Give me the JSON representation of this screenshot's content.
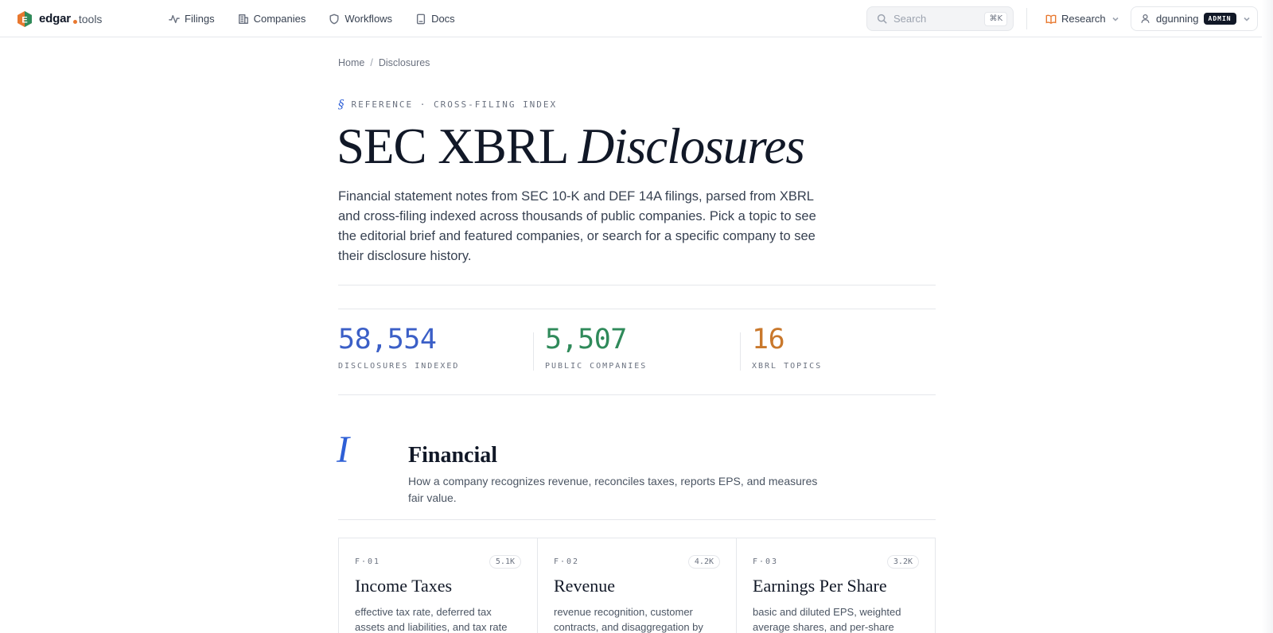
{
  "brand": {
    "logo_letter": "E",
    "name": "edgar",
    "suffix": "tools"
  },
  "nav": [
    {
      "label": "Filings",
      "icon": "activity-icon"
    },
    {
      "label": "Companies",
      "icon": "building-icon"
    },
    {
      "label": "Workflows",
      "icon": "shield-icon"
    },
    {
      "label": "Docs",
      "icon": "document-icon"
    }
  ],
  "search": {
    "placeholder": "Search",
    "shortcut": "⌘K"
  },
  "research": {
    "label": "Research"
  },
  "user": {
    "name": "dgunning",
    "badge": "ADMIN"
  },
  "breadcrumb": {
    "home": "Home",
    "current": "Disclosures"
  },
  "hero": {
    "eyebrow_mark": "§",
    "eyebrow": "REFERENCE · CROSS-FILING INDEX",
    "title_plain": "SEC XBRL ",
    "title_italic": "Disclosures",
    "description": "Financial statement notes from SEC 10-K and DEF 14A filings, parsed from XBRL and cross-filing indexed across thousands of public companies. Pick a topic to see the editorial brief and featured companies, or search for a specific company to see their disclosure history."
  },
  "stats": [
    {
      "value": "58,554",
      "label": "DISCLOSURES INDEXED",
      "color": "#3b5fc7"
    },
    {
      "value": "5,507",
      "label": "PUBLIC COMPANIES",
      "color": "#2f8a5a"
    },
    {
      "value": "16",
      "label": "XBRL TOPICS",
      "color": "#c9782c"
    }
  ],
  "group": {
    "numeral": "I",
    "title": "Financial",
    "description": "How a company recognizes revenue, reconciles taxes, reports EPS, and measures fair value."
  },
  "cards": [
    {
      "code": "F·01",
      "count": "5.1K",
      "title": "Income Taxes",
      "description": "effective tax rate, deferred tax assets and liabilities, and tax rate"
    },
    {
      "code": "F·02",
      "count": "4.2K",
      "title": "Revenue",
      "description": "revenue recognition, customer contracts, and disaggregation by"
    },
    {
      "code": "F·03",
      "count": "3.2K",
      "title": "Earnings Per Share",
      "description": "basic and diluted EPS, weighted average shares, and per-share"
    }
  ],
  "colors": {
    "accent": "#2e5fd6",
    "brand_orange": "#e8782f"
  }
}
